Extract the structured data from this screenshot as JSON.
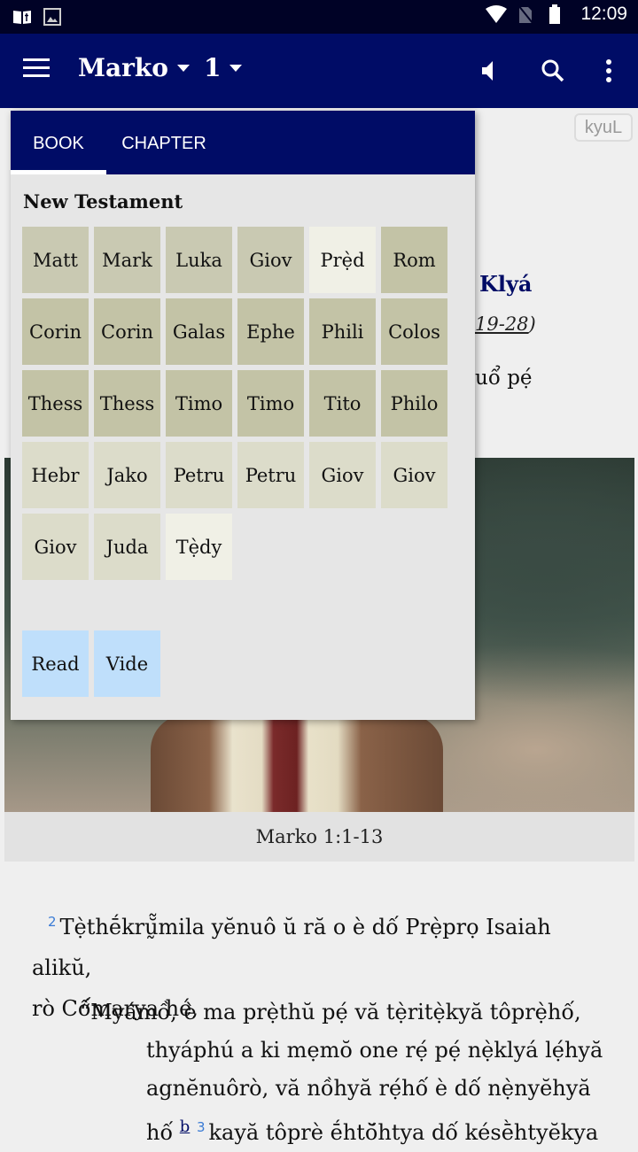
{
  "status_bar": {
    "time": "12:09",
    "left_icons": [
      "bible-app-icon",
      "image-icon"
    ],
    "right_icons": [
      "wifi-icon",
      "no-sim-icon",
      "battery-icon"
    ]
  },
  "app_bar": {
    "book": "Marko",
    "chapter": "1",
    "actions": [
      "audio-icon",
      "search-icon",
      "more-options-icon"
    ]
  },
  "content": {
    "font_toggle": "kyuL",
    "heading_fragment": "Klyá",
    "reference_fragment_link": "19-28",
    "reference_fragment_close": ")",
    "text_fragment": "uổ pẹ́",
    "image_caption": "Marko 1:1-13",
    "verses": [
      {
        "num": "2",
        "text": "Tẹ̀thḗkrṵ̆̃mila yĕnuô ŭ ră o è dố Prẹ̀prọ Isaiah alikŭ,"
      },
      {
        "text": "rò Cố́marya hé,"
      }
    ],
    "poetry": [
      "“Myámồ, è ma prẹ̀thŭ pẹ́ vă tẹ̀ritẹ̀kyă tôprẹ̀hố,",
      "thyáphú a ki mẹmŏ one rẹ́ pẹ́ nẹ̀klyá lẹ́hyă",
      "agnĕnuôrò, vă nồhyă rẹ́hố è dố nẹ̀nyĕhyă"
    ],
    "last_line": {
      "start": "hố",
      "footnote": "b",
      "verse_num": "3",
      "rest": "kayă tôprè ḗhtŏ̆htya dố késḕhtyĕkya"
    }
  },
  "book_picker": {
    "tabs": [
      {
        "label": "BOOK",
        "selected": true
      },
      {
        "label": "CHAPTER",
        "selected": false
      }
    ],
    "section_title": "New Testament",
    "books": [
      {
        "label": "Matt",
        "tone": "c1"
      },
      {
        "label": "Mark",
        "tone": "c1"
      },
      {
        "label": "Luka",
        "tone": "c1"
      },
      {
        "label": "Giov",
        "tone": "c1"
      },
      {
        "label": "Prẹ̀d",
        "tone": "c2"
      },
      {
        "label": "Rom",
        "tone": "c3"
      },
      {
        "label": "Corin",
        "tone": "c3"
      },
      {
        "label": "Corin",
        "tone": "c3"
      },
      {
        "label": "Galas",
        "tone": "c3"
      },
      {
        "label": "Ephe",
        "tone": "c3"
      },
      {
        "label": "Phili",
        "tone": "c3"
      },
      {
        "label": "Colos",
        "tone": "c3"
      },
      {
        "label": "Thess",
        "tone": "c3"
      },
      {
        "label": "Thess",
        "tone": "c3"
      },
      {
        "label": "Timo",
        "tone": "c3"
      },
      {
        "label": "Timo",
        "tone": "c3"
      },
      {
        "label": "Tito",
        "tone": "c3"
      },
      {
        "label": "Philo",
        "tone": "c3"
      },
      {
        "label": "Hebr",
        "tone": "c4"
      },
      {
        "label": "Jako",
        "tone": "c4"
      },
      {
        "label": "Petru",
        "tone": "c4"
      },
      {
        "label": "Petru",
        "tone": "c4"
      },
      {
        "label": "Giov",
        "tone": "c4"
      },
      {
        "label": "Giov",
        "tone": "c4"
      },
      {
        "label": "Giov",
        "tone": "c4"
      },
      {
        "label": "Juda",
        "tone": "c4"
      },
      {
        "label": "Tẹ̀dy",
        "tone": "c2"
      }
    ],
    "extras": [
      {
        "label": "Read"
      },
      {
        "label": "Vide"
      }
    ]
  },
  "colors": {
    "primary": "#000c66",
    "status_bar": "#000226",
    "gospels_tile": "#c9c9b2",
    "letters_tile": "#c3c3a6",
    "general_tile": "#dcdcca",
    "highlight_tile": "#f0f0e6",
    "extra_tile": "#bfdffb"
  }
}
